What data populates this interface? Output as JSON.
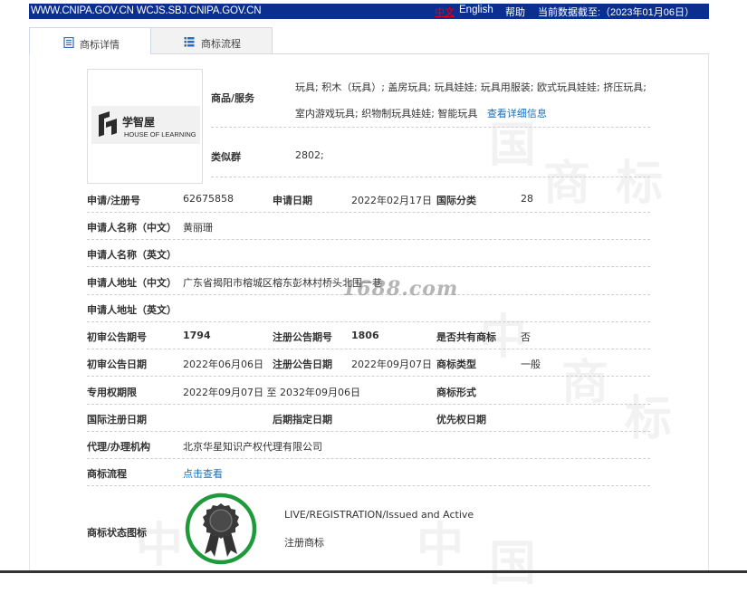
{
  "topbar": {
    "site": "WWW.CNIPA.GOV.CN WCJS.SBJ.CNIPA.GOV.CN",
    "lang_zh": "中文",
    "lang_en": "English",
    "help": "帮助",
    "date_label": "当前数据截至:（2023年01月06日）"
  },
  "tabs": [
    {
      "label": "商标详情",
      "icon": "document-icon"
    },
    {
      "label": "商标流程",
      "icon": "list-icon"
    }
  ],
  "logo": {
    "cn": "学智屋",
    "en": "HOUSE OF LEARNING"
  },
  "goods": {
    "label": "商品/服务",
    "text": "玩具; 积木（玩具）; 盖房玩具; 玩具娃娃; 玩具用服装; 欧式玩具娃娃; 挤压玩具; 室内游戏玩具; 织物制玩具娃娃; 智能玩具",
    "link": "查看详细信息"
  },
  "similar_group": {
    "label": "类似群",
    "value": "2802;"
  },
  "rows": {
    "reg_no_label": "申请/注册号",
    "reg_no": "62675858",
    "app_date_label": "申请日期",
    "app_date": "2022年02月17日",
    "intl_class_label": "国际分类",
    "intl_class": "28",
    "name_cn_label": "申请人名称（中文）",
    "name_cn": "黄丽珊",
    "name_en_label": "申请人名称（英文）",
    "addr_cn_label": "申请人地址（中文）",
    "addr_cn": "广东省揭阳市榕城区榕东彭林村桥头北围一巷",
    "addr_en_label": "申请人地址（英文）",
    "prelim_no_label": "初审公告期号",
    "prelim_no": "1794",
    "reg_pub_no_label": "注册公告期号",
    "reg_pub_no": "1806",
    "shared_label": "是否共有商标",
    "shared": "否",
    "prelim_date_label": "初审公告日期",
    "prelim_date": "2022年06月06日",
    "reg_pub_date_label": "注册公告日期",
    "reg_pub_date": "2022年09月07日",
    "tm_type_label": "商标类型",
    "tm_type": "一般",
    "term_label": "专用权期限",
    "term": "2022年09月07日 至 2032年09月06日",
    "tm_form_label": "商标形式",
    "intl_reg_date_label": "国际注册日期",
    "later_date_label": "后期指定日期",
    "priority_date_label": "优先权日期",
    "agent_label": "代理/办理机构",
    "agent": "北京华星知识产权代理有限公司",
    "flow_label": "商标流程",
    "flow_link": "点击查看",
    "status_label": "商标状态图标",
    "status_en": "LIVE/REGISTRATION/Issued and Active",
    "status_cn": "注册商标"
  },
  "watermark": "1688.com",
  "watermark_chars": [
    "中",
    "国",
    "商",
    "标"
  ],
  "colors": {
    "topbar": "#0b2f8f",
    "link": "#1a6fb8",
    "status_ring": "#1e9a3a",
    "lang_active": "#e60012"
  }
}
